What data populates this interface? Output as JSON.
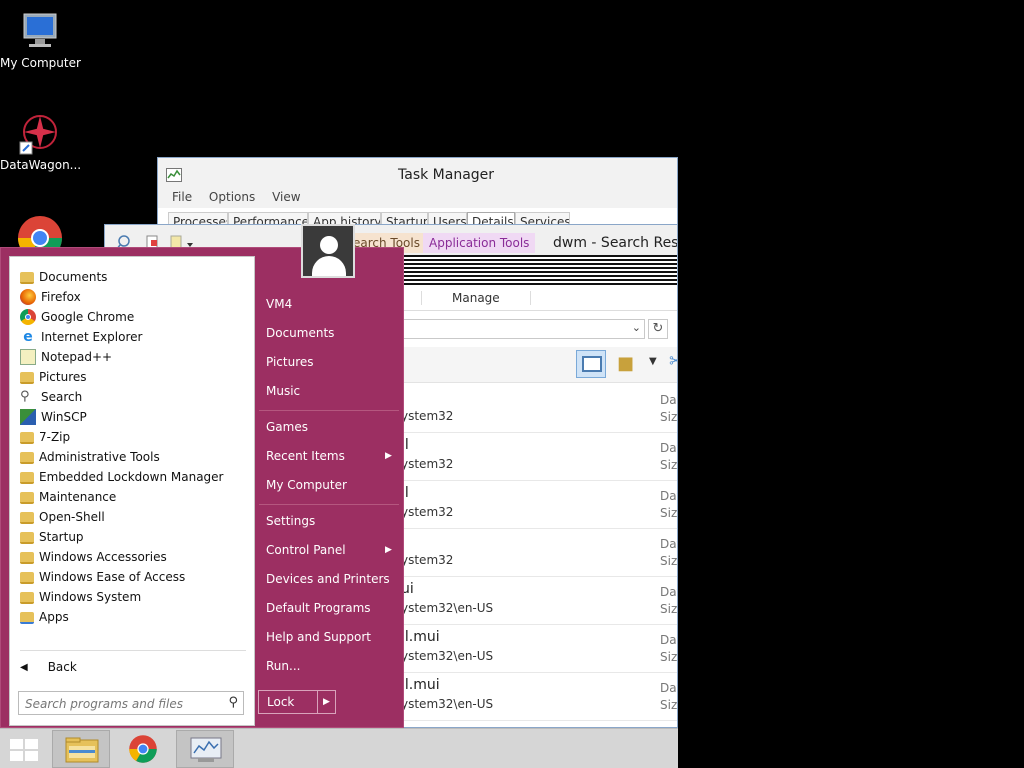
{
  "desktop": {
    "icons": [
      {
        "label": "My Computer"
      },
      {
        "label": "DataWagon..."
      }
    ]
  },
  "task_manager": {
    "title": "Task Manager",
    "menu": [
      "File",
      "Options",
      "View"
    ],
    "tabs": [
      "Processes",
      "Performance",
      "App history",
      "Startup",
      "Users",
      "Details",
      "Services"
    ],
    "active_tab": "Details"
  },
  "explorer": {
    "tab_search_tools": "earch Tools",
    "tab_application_tools": "Application Tools",
    "title": "dwm - Search Resu",
    "manage_label": "Manage",
    "rows": [
      {
        "name": "",
        "path": "ystem32",
        "date": "Dat",
        "size": "Size"
      },
      {
        "name": "ll",
        "path": "ystem32",
        "date": "Dat",
        "size": "Size"
      },
      {
        "name": "ll",
        "path": "ystem32",
        "date": "Dat",
        "size": "Size"
      },
      {
        "name": "",
        "path": "ystem32",
        "date": "Dat",
        "size": "Size"
      },
      {
        "name": "ui",
        "path": "ystem32\\en-US",
        "date": "Dat",
        "size": "Size"
      },
      {
        "name": "ll.mui",
        "path": "ystem32\\en-US",
        "date": "Dat",
        "size": "Size"
      },
      {
        "name": "ll.mui",
        "path": "ystem32\\en-US",
        "date": "Dat",
        "size": "Size"
      }
    ]
  },
  "start_menu": {
    "programs": [
      {
        "label": "Documents",
        "icon": "folder-icon"
      },
      {
        "label": "Firefox",
        "icon": "firefox-icon"
      },
      {
        "label": "Google Chrome",
        "icon": "chrome-icon"
      },
      {
        "label": "Internet Explorer",
        "icon": "ie-icon"
      },
      {
        "label": "Notepad++",
        "icon": "notepadpp-icon"
      },
      {
        "label": "Pictures",
        "icon": "folder-icon"
      },
      {
        "label": "Search",
        "icon": "search-icon"
      },
      {
        "label": "WinSCP",
        "icon": "winscp-icon"
      },
      {
        "label": "7-Zip",
        "icon": "folder-icon"
      },
      {
        "label": "Administrative Tools",
        "icon": "folder-icon"
      },
      {
        "label": "Embedded Lockdown Manager",
        "icon": "folder-icon"
      },
      {
        "label": "Maintenance",
        "icon": "folder-icon"
      },
      {
        "label": "Open-Shell",
        "icon": "folder-icon"
      },
      {
        "label": "Startup",
        "icon": "folder-icon"
      },
      {
        "label": "Windows Accessories",
        "icon": "folder-icon"
      },
      {
        "label": "Windows Ease of Access",
        "icon": "folder-icon"
      },
      {
        "label": "Windows System",
        "icon": "folder-icon"
      },
      {
        "label": "Apps",
        "icon": "apps-icon"
      }
    ],
    "back_label": "Back",
    "search_placeholder": "Search programs and files",
    "right_items": [
      {
        "label": "VM4"
      },
      {
        "label": "Documents"
      },
      {
        "label": "Pictures"
      },
      {
        "label": "Music"
      },
      {
        "label": "Games"
      },
      {
        "label": "Recent Items",
        "submenu": true
      },
      {
        "label": "My Computer"
      },
      {
        "label": "Settings"
      },
      {
        "label": "Control Panel",
        "submenu": true
      },
      {
        "label": "Devices and Printers"
      },
      {
        "label": "Default Programs"
      },
      {
        "label": "Help and Support"
      },
      {
        "label": "Run..."
      }
    ],
    "lock_label": "Lock",
    "accent_color": "#9c2f62"
  },
  "taskbar": {
    "buttons": [
      "start-button",
      "file-explorer",
      "google-chrome",
      "task-manager"
    ]
  }
}
